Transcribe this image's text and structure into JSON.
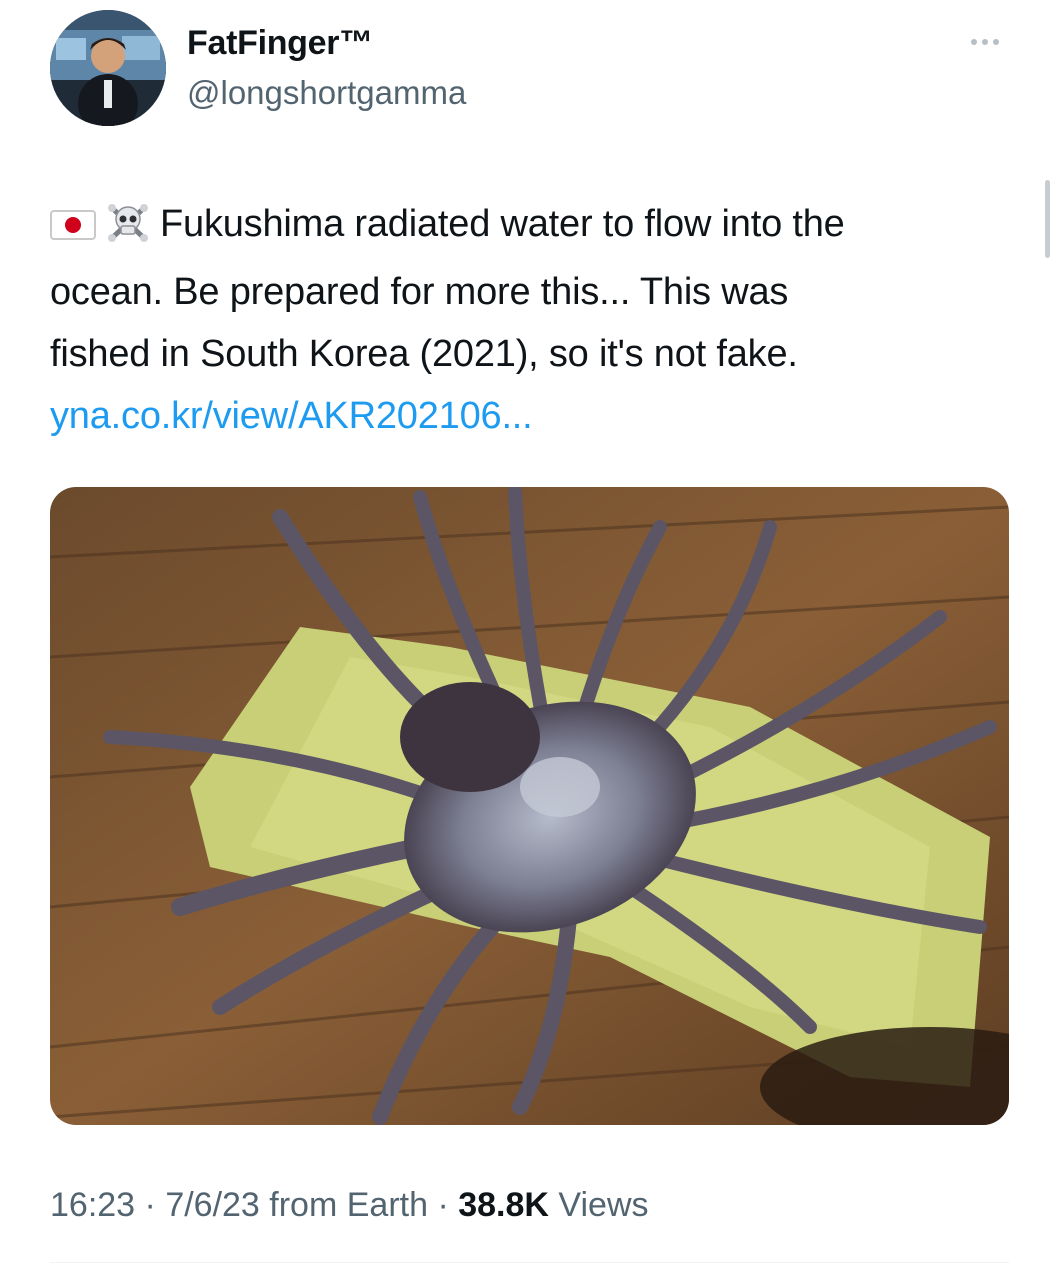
{
  "author": {
    "display_name": "FatFinger™",
    "handle": "@longshortgamma"
  },
  "tweet": {
    "emojis": [
      "japan-flag",
      "skull-and-crossbones"
    ],
    "lines": [
      "Fukushima radiated water to flow into the",
      "ocean. Be prepared for more this... This was",
      "fished in South Korea (2021), so it's not fake."
    ],
    "link": "yna.co.kr/view/AKR202106..."
  },
  "meta": {
    "time": "16:23",
    "sep1": " · ",
    "date": "7/6/23",
    "source": " from Earth",
    "sep2": " · ",
    "views_count": "38.8K",
    "views_label": " Views"
  },
  "colors": {
    "link": "#1d9bf0",
    "secondary_text": "#536471",
    "primary_text": "#0f1419"
  }
}
